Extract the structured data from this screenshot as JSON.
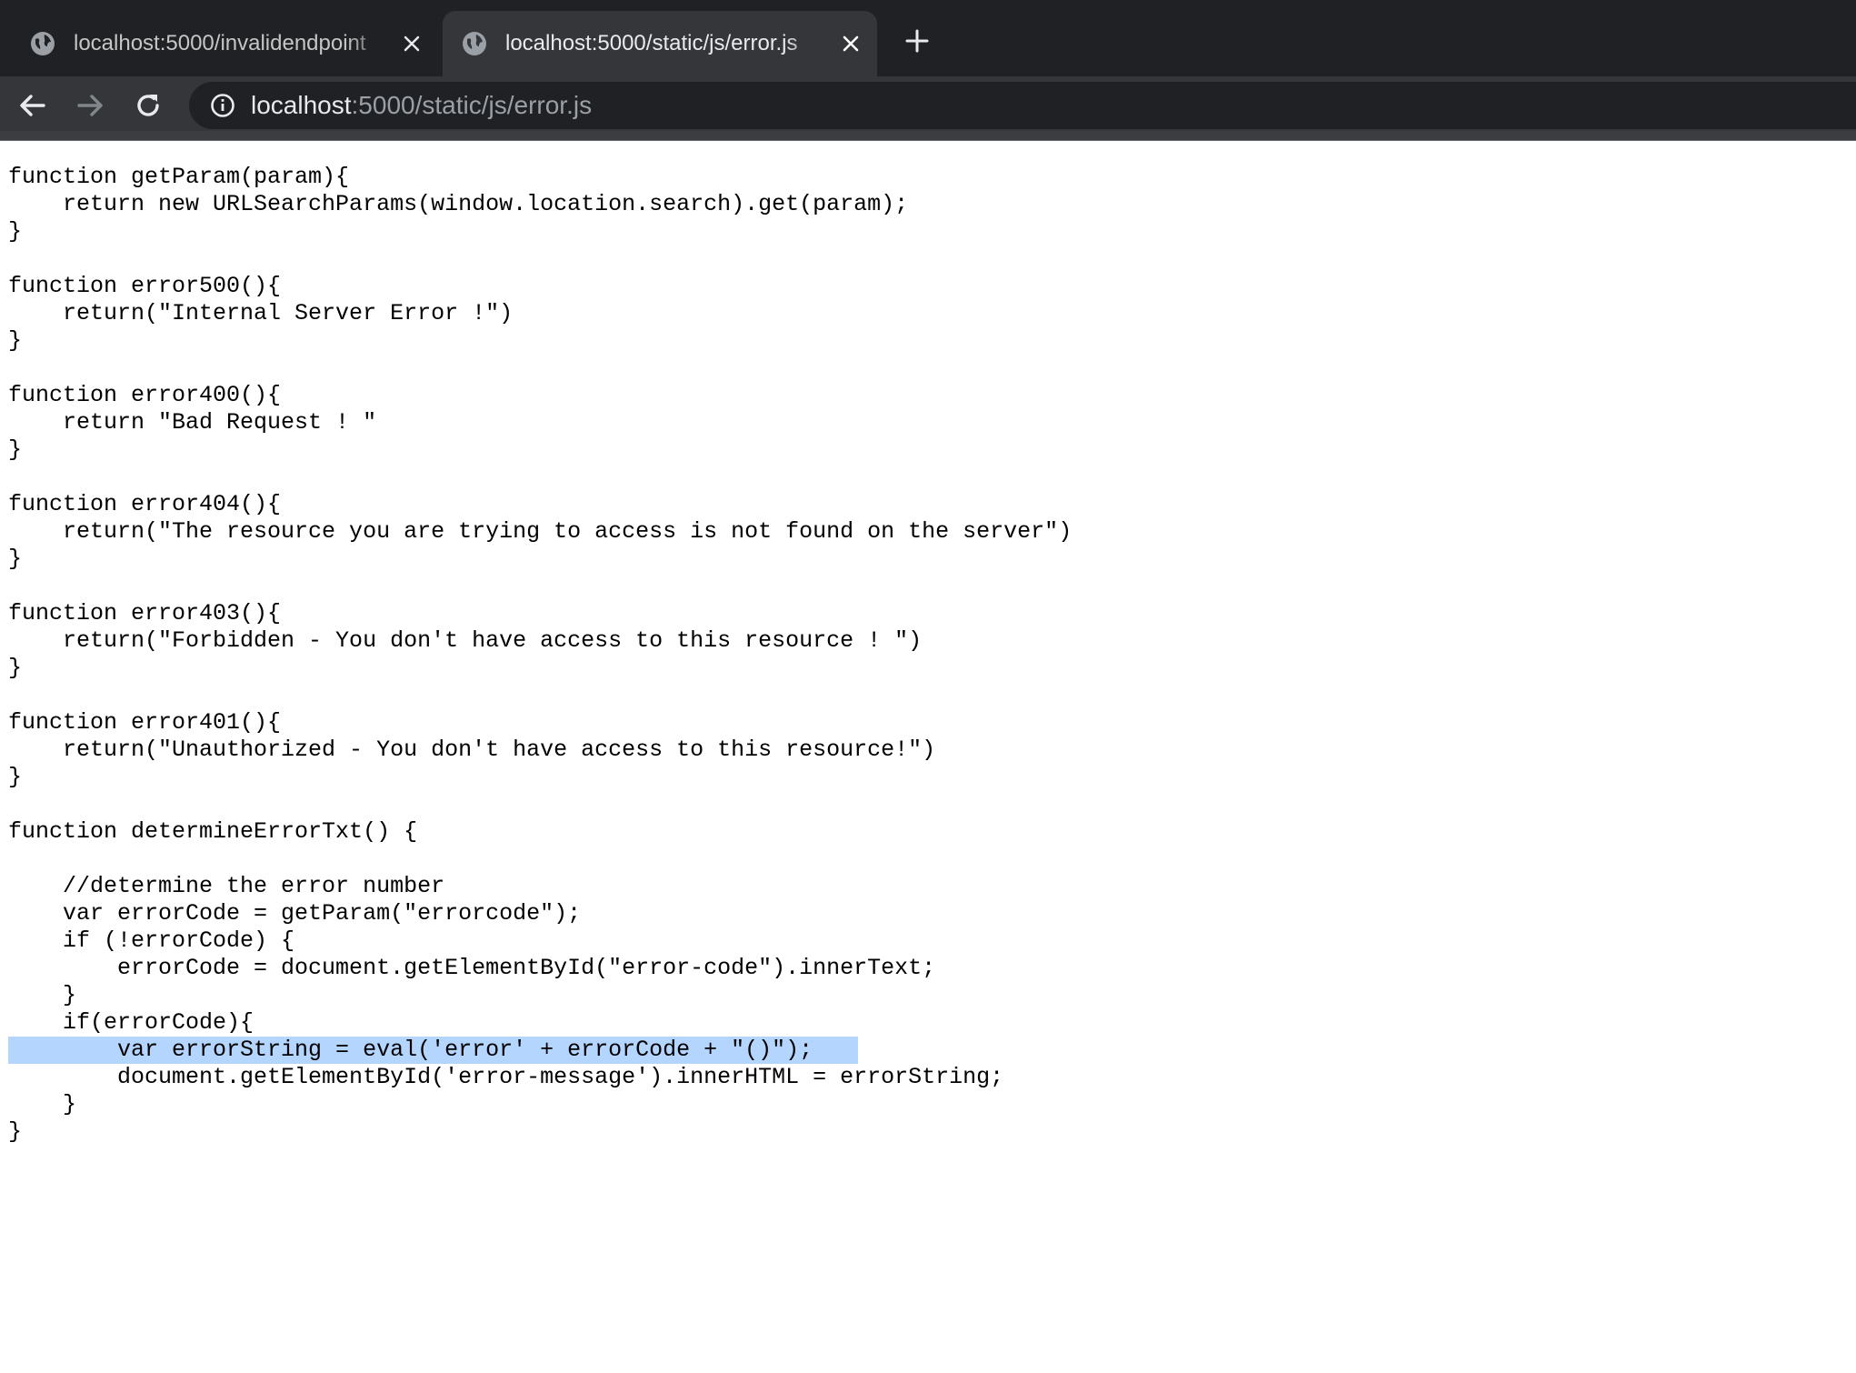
{
  "browser": {
    "tabs": [
      {
        "title": "localhost:5000/invalidendpoint",
        "active": false,
        "favicon": "globe-icon"
      },
      {
        "title": "localhost:5000/static/js/error.js",
        "active": true,
        "favicon": "globe-icon"
      }
    ],
    "new_tab_icon": "plus-icon",
    "address_bar": {
      "host": "localhost",
      "path": ":5000/static/js/error.js",
      "security_icon": "info-icon"
    },
    "nav_icons": [
      "back-arrow-icon",
      "forward-arrow-icon",
      "reload-icon"
    ]
  },
  "source": {
    "lines": [
      "function getParam(param){",
      "    return new URLSearchParams(window.location.search).get(param);",
      "}",
      "",
      "function error500(){",
      "    return(\"Internal Server Error !\")",
      "}",
      "",
      "function error400(){",
      "    return \"Bad Request ! \"",
      "}",
      "",
      "function error404(){",
      "    return(\"The resource you are trying to access is not found on the server\")",
      "}",
      "",
      "function error403(){",
      "    return(\"Forbidden - You don't have access to this resource ! \")",
      "}",
      "",
      "function error401(){",
      "    return(\"Unauthorized - You don't have access to this resource!\")",
      "}",
      "",
      "function determineErrorTxt() {",
      "",
      "    //determine the error number",
      "    var errorCode = getParam(\"errorcode\");",
      "    if (!errorCode) {",
      "        errorCode = document.getElementById(\"error-code\").innerText;",
      "    }",
      "    if(errorCode){",
      "        var errorString = eval('error' + errorCode + \"()\");",
      "        document.getElementById('error-message').innerHTML = errorString;",
      "    }",
      "}"
    ],
    "highlighted_line": "        var errorString = eval('error' + errorCode + \"()\");",
    "highlight_color": "#b4d5fe"
  },
  "colors": {
    "tabstrip_bg": "#202124",
    "active_tab_bg": "#35363a",
    "omnibox_bg": "#202124",
    "page_bg": "#ffffff"
  }
}
